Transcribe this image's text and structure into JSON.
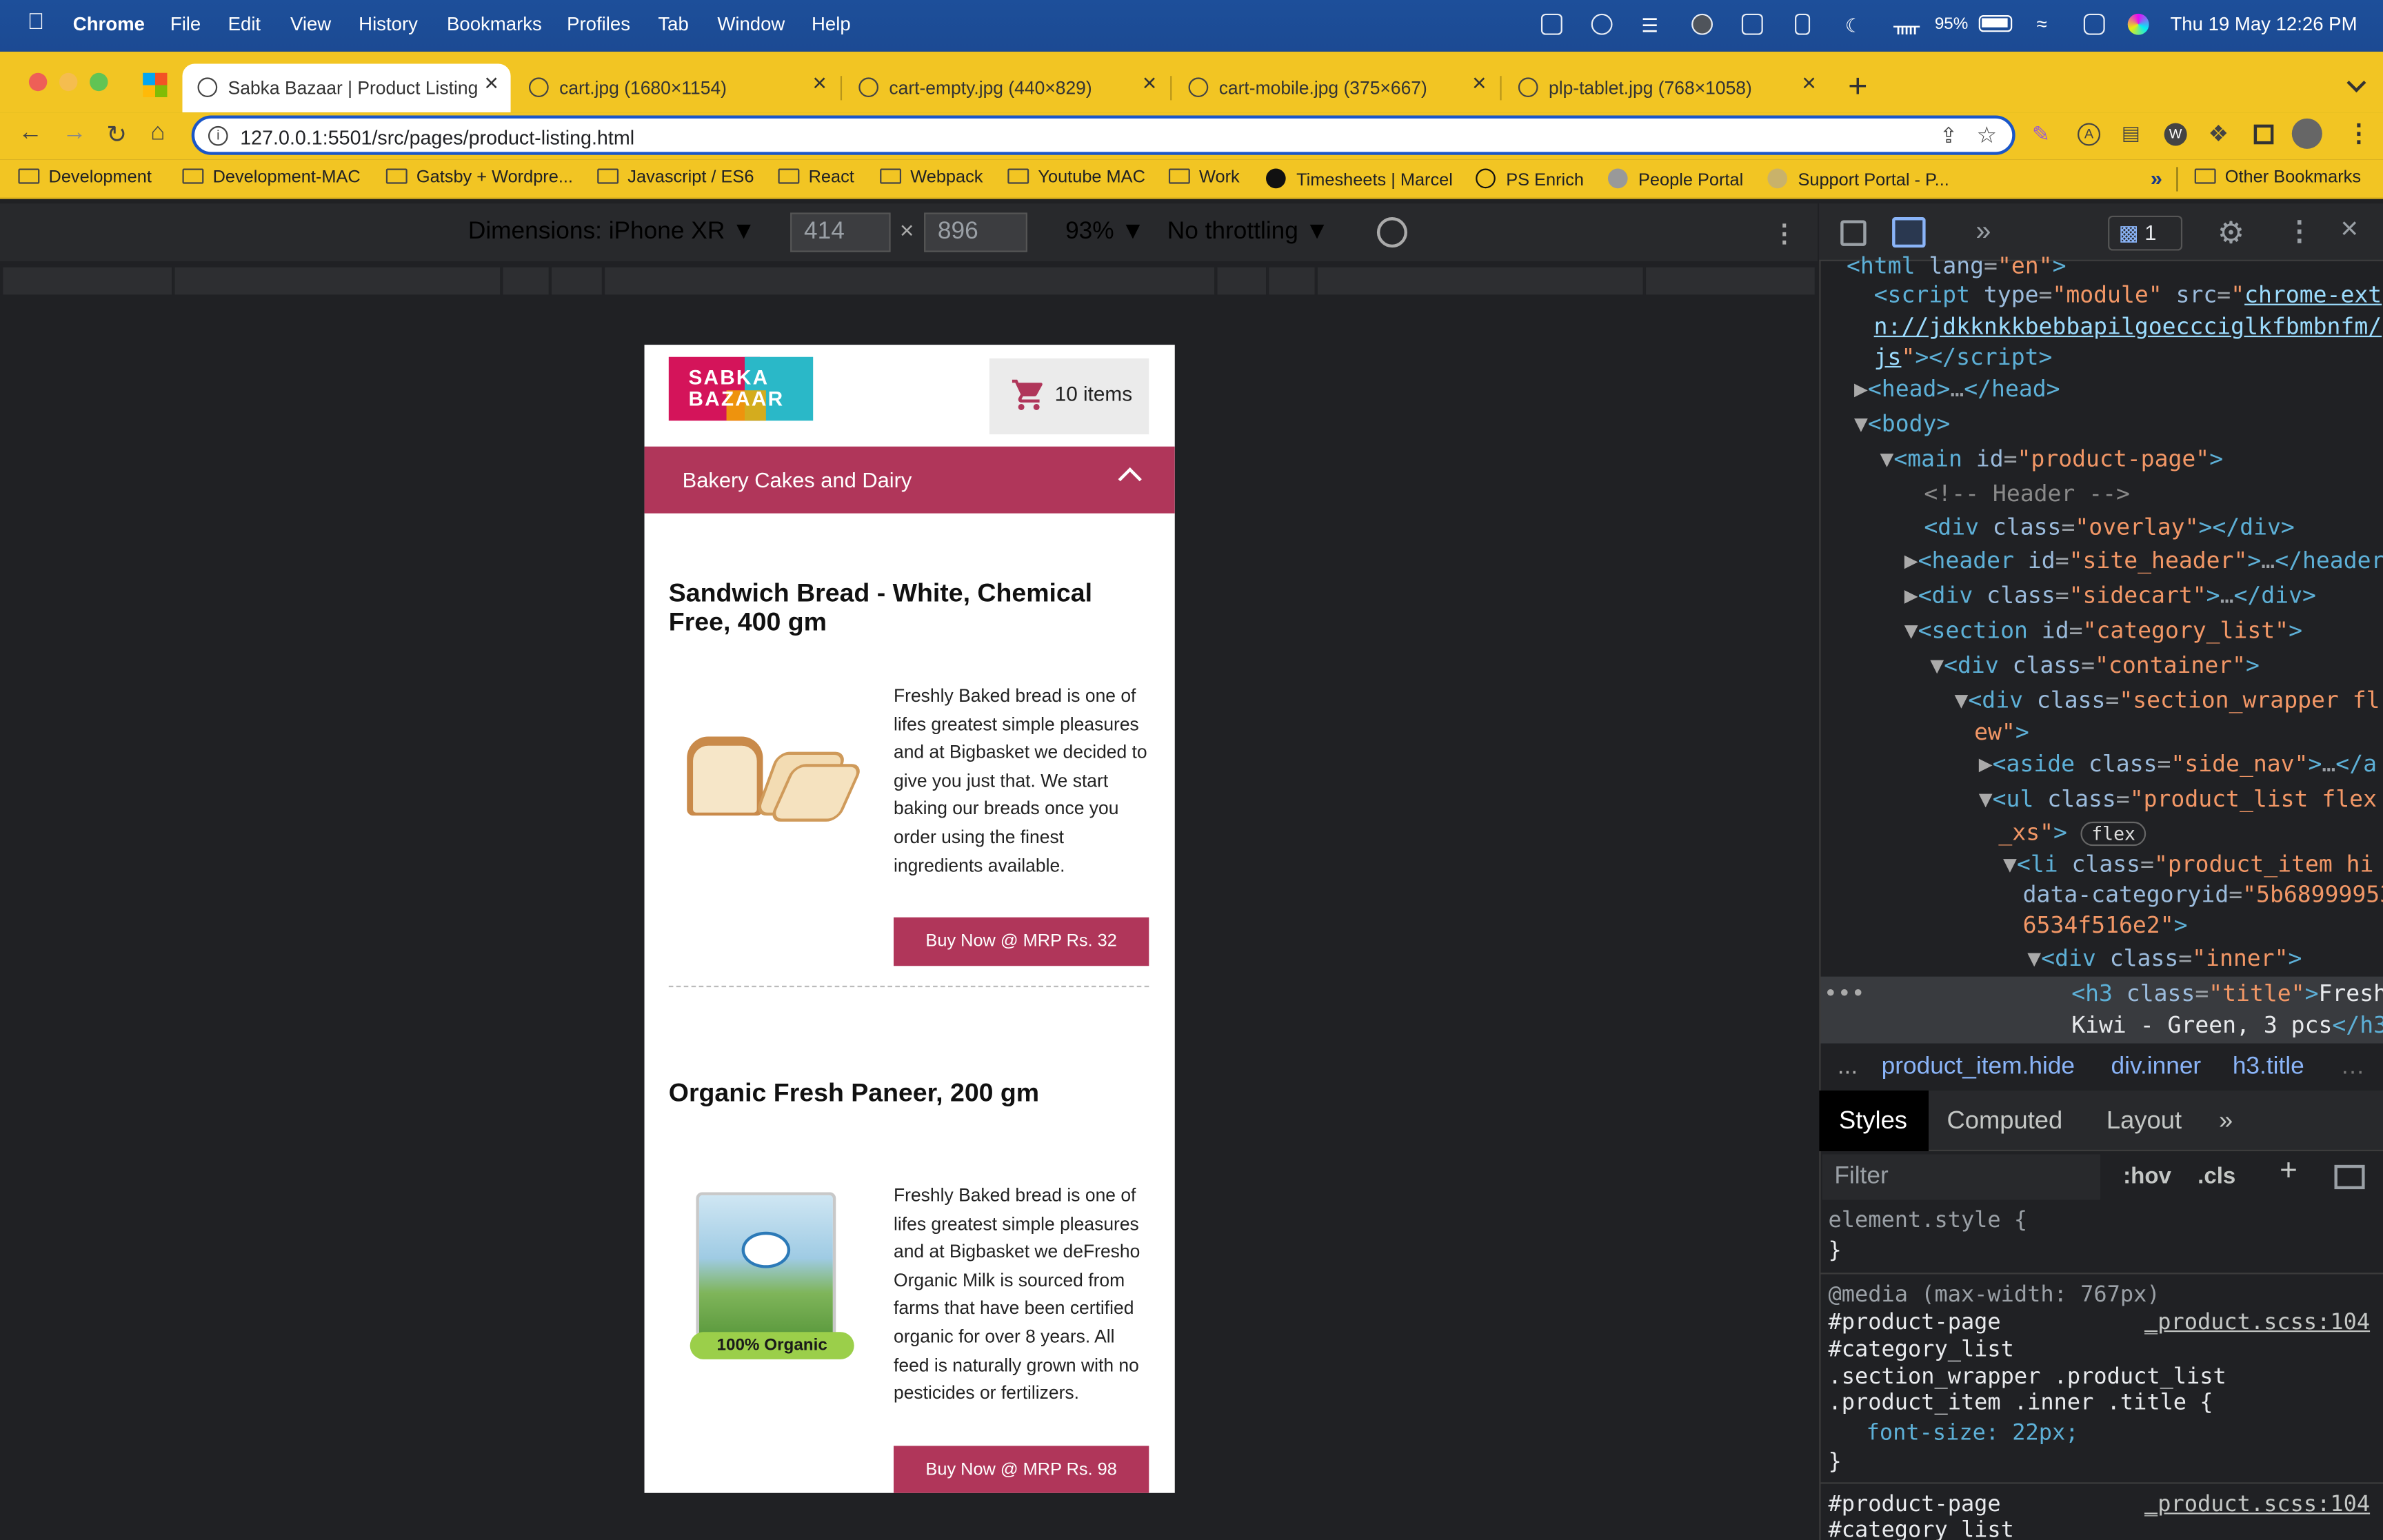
{
  "menubar": {
    "app": "Chrome",
    "items": [
      "File",
      "Edit",
      "View",
      "History",
      "Bookmarks",
      "Profiles",
      "Tab",
      "Window",
      "Help"
    ],
    "battery": "95%",
    "datetime": "Thu 19 May  12:26 PM"
  },
  "tabs": [
    {
      "title": "Sabka Bazaar | Product Listing"
    },
    {
      "title": "cart.jpg (1680×1154)"
    },
    {
      "title": "cart-empty.jpg (440×829)"
    },
    {
      "title": "cart-mobile.jpg (375×667)"
    },
    {
      "title": "plp-tablet.jpg (768×1058)"
    }
  ],
  "address": {
    "url": "127.0.0.1:5501/src/pages/product-listing.html"
  },
  "bookmarks": [
    "Development",
    "Development-MAC",
    "Gatsby + Wordpre...",
    "Javascript / ES6",
    "React",
    "Webpack",
    "Youtube MAC",
    "Work",
    "Timesheets | Marcel",
    "PS Enrich",
    "People Portal",
    "Support Portal - P...",
    "Other Bookmarks"
  ],
  "device": {
    "label": "Dimensions: iPhone XR",
    "width": "414",
    "height": "896",
    "zoom": "93%",
    "throttle": "No throttling"
  },
  "page": {
    "logo": "SABKA BAZAAR",
    "cart": "10 items",
    "category": "Bakery Cakes and Dairy",
    "products": [
      {
        "title": "Sandwich Bread - White, Chemical Free, 400 gm",
        "desc": "Freshly Baked bread is one of lifes greatest simple pleasures and at Bigbasket we decided to give you just that. We start baking our breads once you order using the finest ingredients available.",
        "buy": "Buy Now @ MRP Rs. 32"
      },
      {
        "title": "Organic Fresh Paneer, 200 gm",
        "desc": "Freshly Baked bread is one of lifes greatest simple pleasures and at Bigbasket we deFresho Organic Milk is sourced from farms that have been certified organic for over 8 years. All feed is naturally grown with no pesticides or fertilizers.",
        "buy": "Buy Now @ MRP Rs. 98",
        "badge": "100% Organic"
      }
    ]
  },
  "devtools": {
    "issues": "1",
    "breadcrumbs": [
      "...",
      "product_item.hide",
      "div.inner",
      "h3.title"
    ],
    "tabs": [
      "Styles",
      "Computed",
      "Layout"
    ],
    "filter": "Filter",
    "hov": ":hov",
    "cls": ".cls",
    "element_style": "element.style {",
    "media": "@media (max-width: 767px)",
    "rule1": [
      "#product-page",
      "#category_list",
      ".section_wrapper .product_list",
      ".product_item .inner .title {"
    ],
    "rule1_prop": "font-size: 22px;",
    "source": "_product.scss:104",
    "rule2": [
      "#product-page",
      "#category_list"
    ]
  }
}
